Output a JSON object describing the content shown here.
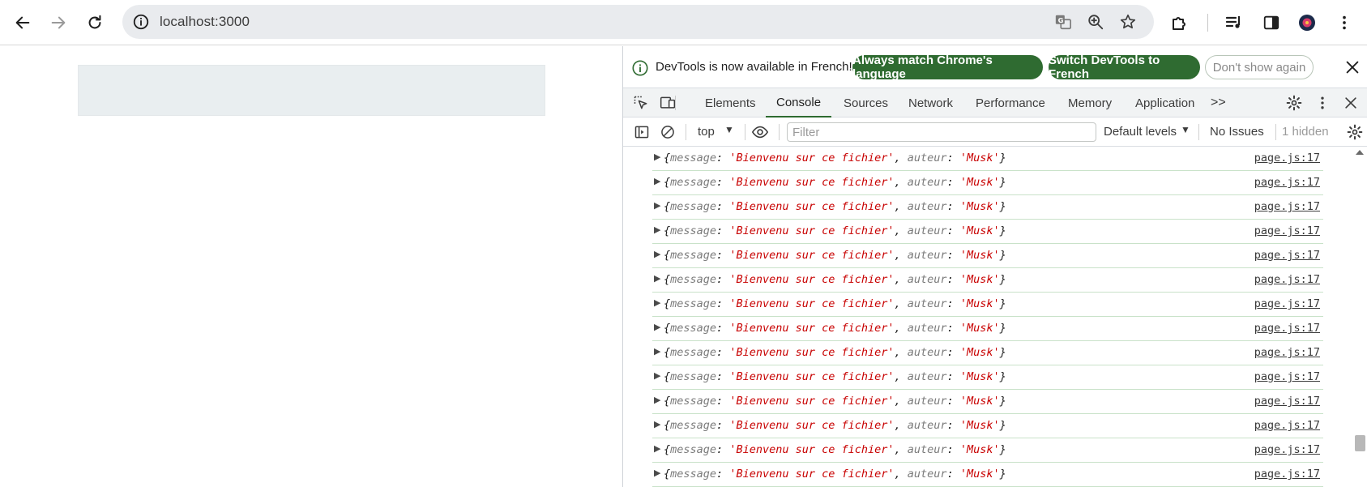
{
  "browser": {
    "url": "localhost:3000",
    "icons": [
      "back-arrow-icon",
      "forward-arrow-icon",
      "reload-icon",
      "site-info-icon",
      "translate-icon",
      "zoom-icon",
      "bookmark-star-icon",
      "extensions-puzzle-icon",
      "media-queue-icon",
      "side-panel-icon",
      "profile-avatar-icon",
      "more-menu-icon"
    ]
  },
  "devtools": {
    "infobar": {
      "text": "DevTools is now available in French!",
      "match_label": "Always match Chrome's language",
      "switch_label": "Switch DevTools to French",
      "dismiss_label": "Don't show again"
    },
    "tabs": [
      {
        "label": "Elements"
      },
      {
        "label": "Console"
      },
      {
        "label": "Sources"
      },
      {
        "label": "Network"
      },
      {
        "label": "Performance"
      },
      {
        "label": "Memory"
      },
      {
        "label": "Application"
      }
    ],
    "more_tabs": ">>",
    "active_tab": "Console",
    "toolbar": {
      "context": "top",
      "filter_placeholder": "Filter",
      "levels": "Default levels",
      "issues": "No Issues",
      "hidden": "1 hidden"
    },
    "console": {
      "rows": [
        {
          "k1": "message",
          "v1": "'Bienvenu sur ce fichier'",
          "k2": "auteur",
          "v2": "'Musk'",
          "src": "page.js:17"
        },
        {
          "k1": "message",
          "v1": "'Bienvenu sur ce fichier'",
          "k2": "auteur",
          "v2": "'Musk'",
          "src": "page.js:17"
        },
        {
          "k1": "message",
          "v1": "'Bienvenu sur ce fichier'",
          "k2": "auteur",
          "v2": "'Musk'",
          "src": "page.js:17"
        },
        {
          "k1": "message",
          "v1": "'Bienvenu sur ce fichier'",
          "k2": "auteur",
          "v2": "'Musk'",
          "src": "page.js:17"
        },
        {
          "k1": "message",
          "v1": "'Bienvenu sur ce fichier'",
          "k2": "auteur",
          "v2": "'Musk'",
          "src": "page.js:17"
        },
        {
          "k1": "message",
          "v1": "'Bienvenu sur ce fichier'",
          "k2": "auteur",
          "v2": "'Musk'",
          "src": "page.js:17"
        },
        {
          "k1": "message",
          "v1": "'Bienvenu sur ce fichier'",
          "k2": "auteur",
          "v2": "'Musk'",
          "src": "page.js:17"
        },
        {
          "k1": "message",
          "v1": "'Bienvenu sur ce fichier'",
          "k2": "auteur",
          "v2": "'Musk'",
          "src": "page.js:17"
        },
        {
          "k1": "message",
          "v1": "'Bienvenu sur ce fichier'",
          "k2": "auteur",
          "v2": "'Musk'",
          "src": "page.js:17"
        },
        {
          "k1": "message",
          "v1": "'Bienvenu sur ce fichier'",
          "k2": "auteur",
          "v2": "'Musk'",
          "src": "page.js:17"
        },
        {
          "k1": "message",
          "v1": "'Bienvenu sur ce fichier'",
          "k2": "auteur",
          "v2": "'Musk'",
          "src": "page.js:17"
        },
        {
          "k1": "message",
          "v1": "'Bienvenu sur ce fichier'",
          "k2": "auteur",
          "v2": "'Musk'",
          "src": "page.js:17"
        },
        {
          "k1": "message",
          "v1": "'Bienvenu sur ce fichier'",
          "k2": "auteur",
          "v2": "'Musk'",
          "src": "page.js:17"
        },
        {
          "k1": "message",
          "v1": "'Bienvenu sur ce fichier'",
          "k2": "auteur",
          "v2": "'Musk'",
          "src": "page.js:17"
        }
      ]
    }
  },
  "colors": {
    "accent_green": "#2f6b31",
    "string_red": "#c80000",
    "row_divider": "#c9e2c9"
  }
}
